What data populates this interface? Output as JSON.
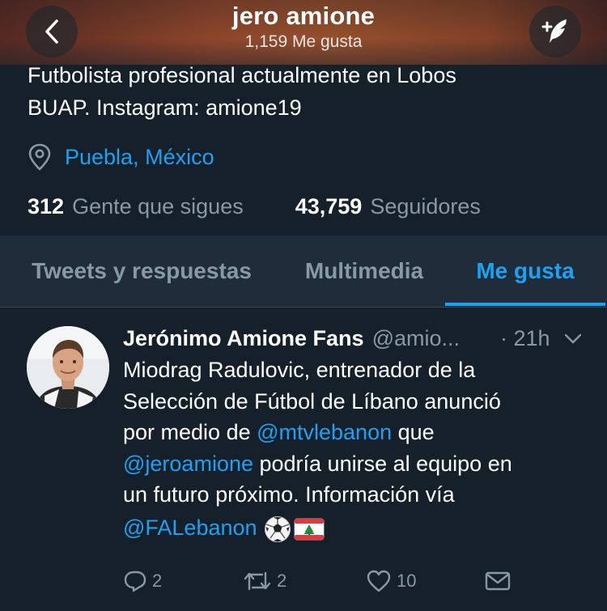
{
  "header": {
    "title": "jero amione",
    "subtitle": "1,159 Me gusta"
  },
  "profile": {
    "bio_line1": "Futbolista profesional actualmente en Lobos",
    "bio_line2": "BUAP. Instagram: amione19",
    "location": "Puebla, México",
    "following_count": "312",
    "following_label": "Gente que sigues",
    "followers_count": "43,759",
    "followers_label": "Seguidores"
  },
  "tabs": [
    {
      "label": "Tweets y respuestas",
      "active": false
    },
    {
      "label": "Multimedia",
      "active": false
    },
    {
      "label": "Me gusta",
      "active": true
    }
  ],
  "tweet": {
    "name": "Jerónimo Amione Fans",
    "handle": "@amio...",
    "time": "· 21h",
    "text_1": "Miodrag Radulovic, entrenador de la",
    "text_2": "Selección de Fútbol de Líbano anunció",
    "text_3a": "por medio de ",
    "mention_1": "@mtvlebanon",
    "text_3b": " que",
    "mention_2": "@jeroamione",
    "text_4b": " podría unirse al equipo en",
    "text_5": "un futuro próximo. Información vía",
    "mention_3": "@FALebanon",
    "replies": "2",
    "retweets": "2",
    "likes": "10"
  },
  "icons": {
    "back": "chevron-left-icon",
    "compose": "feather-compose-icon",
    "location": "location-pin-icon",
    "caret": "chevron-down-icon",
    "reply": "reply-icon",
    "retweet": "retweet-icon",
    "like": "heart-icon",
    "dm": "envelope-icon",
    "emoji_1": "soccer-ball",
    "emoji_2": "lebanon-flag"
  },
  "colors": {
    "background": "#15202b",
    "accent": "#1da1f2",
    "muted": "#8899a6"
  }
}
